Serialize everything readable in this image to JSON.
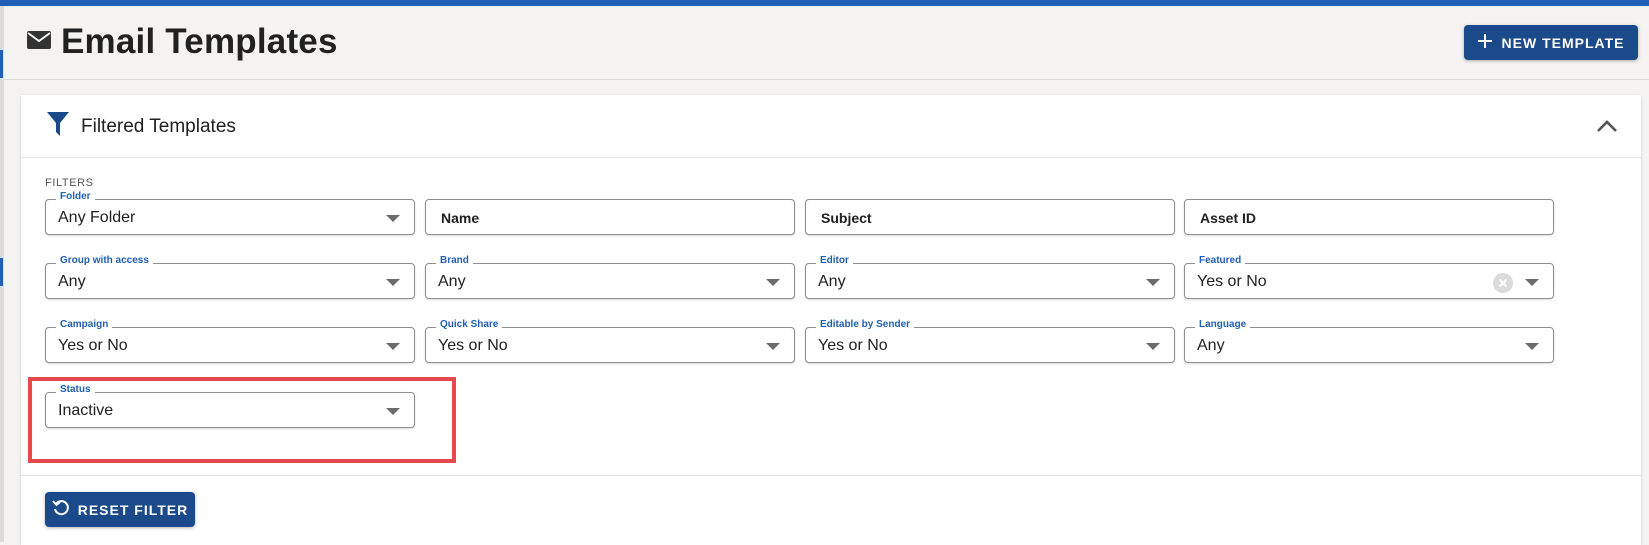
{
  "header": {
    "title": "Email Templates",
    "new_button_label": "NEW TEMPLATE"
  },
  "panel": {
    "title": "Filtered Templates",
    "filters_label": "FILTERS",
    "reset_label": "RESET FILTER"
  },
  "filters": {
    "folder": {
      "label": "Folder",
      "value": "Any Folder"
    },
    "name": {
      "placeholder": "Name"
    },
    "subject": {
      "placeholder": "Subject"
    },
    "asset_id": {
      "placeholder": "Asset ID"
    },
    "group_with_access": {
      "label": "Group with access",
      "value": "Any"
    },
    "brand": {
      "label": "Brand",
      "value": "Any"
    },
    "editor": {
      "label": "Editor",
      "value": "Any"
    },
    "featured": {
      "label": "Featured",
      "value": "Yes or No"
    },
    "campaign": {
      "label": "Campaign",
      "value": "Yes or No"
    },
    "quick_share": {
      "label": "Quick Share",
      "value": "Yes or No"
    },
    "editable_by_sender": {
      "label": "Editable by Sender",
      "value": "Yes or No"
    },
    "language": {
      "label": "Language",
      "value": "Any"
    },
    "status": {
      "label": "Status",
      "value": "Inactive"
    }
  },
  "colors": {
    "accent": "#1a4a8a",
    "label_blue": "#1f5fb4",
    "highlight": "#e8474b"
  }
}
